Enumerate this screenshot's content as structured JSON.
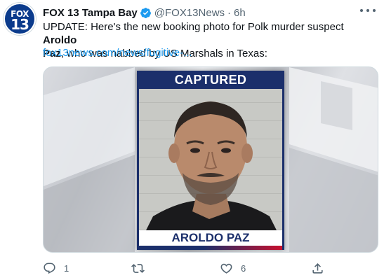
{
  "tweet": {
    "avatar": {
      "line1": "FOX",
      "line2": "13"
    },
    "display_name": "FOX 13 Tampa Bay",
    "handle": "@FOX13News",
    "separator": "·",
    "time": "6h",
    "text": {
      "part1": "UPDATE: Here's the new booking photo for Polk murder suspect ",
      "bold1": "Aroldo",
      "bold2": "Paz",
      "part2": ", who was nabbed by US Marshals in Texas:"
    },
    "link": "fox13news.com/news/fugitive-..."
  },
  "media": {
    "banner_label": "CAPTURED",
    "name_label": "AROLDO PAZ"
  },
  "actions": {
    "reply_count": "1",
    "retweet_count": "",
    "like_count": "6"
  },
  "colors": {
    "link": "#1d9bf0",
    "verified": "#1d9bf0",
    "navy": "#1b2f6b",
    "muted": "#536471"
  },
  "icons": [
    "verified-badge-icon",
    "more-icon",
    "reply-icon",
    "retweet-icon",
    "like-icon",
    "share-icon"
  ]
}
